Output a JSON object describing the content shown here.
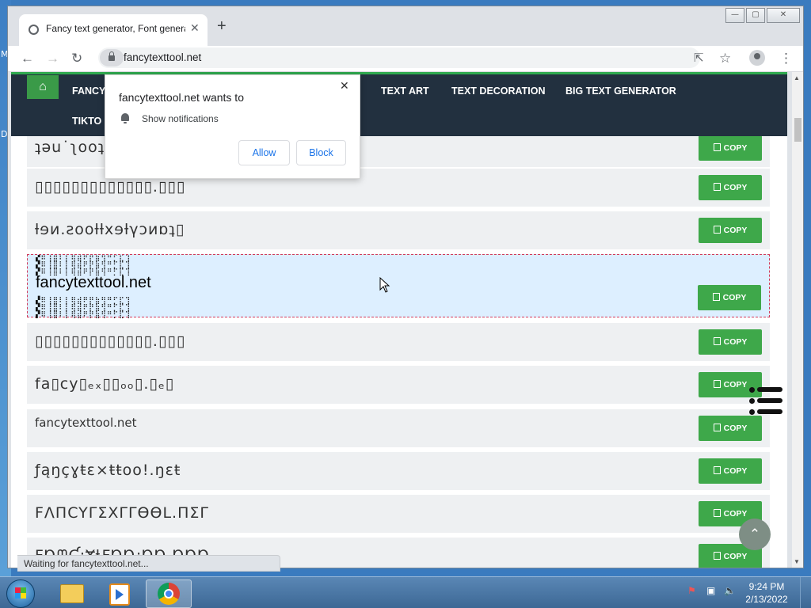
{
  "desktop": {
    "edge_letters": [
      "M",
      "D"
    ]
  },
  "window": {
    "controls": [
      "—",
      "▢",
      "✕"
    ]
  },
  "browser": {
    "tab": {
      "title": "Fancy text generator, Font generator",
      "close": "✕"
    },
    "new_tab": "+",
    "nav": {
      "back": "←",
      "forward": "→",
      "reload": "↻"
    },
    "url": "fancytexttool.net",
    "toolbar_icons": [
      "share-icon",
      "star-icon",
      "profile-icon",
      "kebab-menu-icon"
    ],
    "toolbar_glyphs": {
      "share": "⇱",
      "star": "☆",
      "menu": "⋮"
    }
  },
  "site_nav": {
    "home_glyph": "⌂",
    "items": [
      "FANCY",
      "S",
      "TEXT ART",
      "TEXT DECORATION",
      "BIG TEXT GENERATOR"
    ],
    "second_row": [
      "TIKTO"
    ]
  },
  "popup": {
    "title": "fancytexttool.net wants to",
    "close": "✕",
    "permission": "Show notifications",
    "allow": "Allow",
    "block": "Block"
  },
  "results": {
    "copy_label": "COPY",
    "rows": [
      "ʇəu˙ʅooʇ",
      "▯▯▯▯▯▯▯▯▯▯▯▯▯.▯▯▯",
      "ƚɘᴎ.ꙅooƚƚxɘƚγɔᴎɒʇ▯",
      "fancytexttool.net",
      "▯▯▯▯▯▯▯▯▯▯▯▯▯.▯▯▯",
      "fa▯cy▯ₑₓ▯▯ₒₒ▯.▯ₑ▯",
      "fancytexttool.net",
      "ƒąŋçɣŧɛ×ŧŧoo!.ŋɛŧ",
      "FΛПCYΓΣXΓΓӨӨL.ПΣΓ",
      "ƑⱰᗰƇ:Ɏⱡ₣ⱰⱰ:ⱰⱰ.ⱰⱰⱰ"
    ],
    "zalgo_glyphs": "▞⠿⢸⣿⠇⡇⢿⣾⠟⡟⣷⢻⠛⡋⣏⢹"
  },
  "status": "Waiting for fancytexttool.net...",
  "fabs": {
    "menu": "menu-list-icon",
    "top_glyph": "⌃"
  },
  "taskbar": {
    "apps": [
      "explorer",
      "media-player",
      "chrome"
    ],
    "tray_glyphs": [
      "⚑",
      "▣",
      "🔈"
    ],
    "time": "9:24 PM",
    "date": "2/13/2022"
  }
}
